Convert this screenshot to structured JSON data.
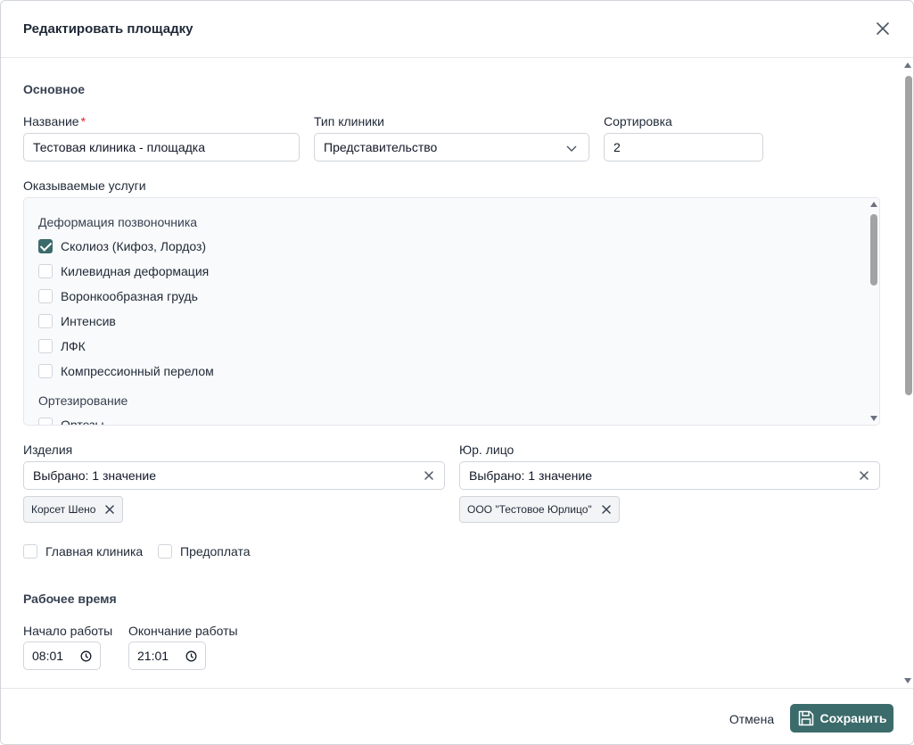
{
  "dialog": {
    "title": "Редактировать площадку",
    "close_icon": "close-icon"
  },
  "basic": {
    "section_title": "Основное",
    "name_label": "Название",
    "name_required_mark": "*",
    "name_value": "Тестовая клиника - площадка",
    "clinic_type_label": "Тип клиники",
    "clinic_type_value": "Представительство",
    "sort_label": "Сортировка",
    "sort_value": "2"
  },
  "services": {
    "label": "Оказываемые услуги",
    "groups": [
      {
        "title": "Деформация позвоночника",
        "items": [
          {
            "label": "Сколиоз (Кифоз, Лордоз)",
            "checked": true
          },
          {
            "label": "Килевидная деформация",
            "checked": false
          },
          {
            "label": "Воронкообразная грудь",
            "checked": false
          },
          {
            "label": "Интенсив",
            "checked": false
          },
          {
            "label": "ЛФК",
            "checked": false
          },
          {
            "label": "Компрессионный перелом",
            "checked": false
          }
        ]
      },
      {
        "title": "Ортезирование",
        "items": [
          {
            "label": "Ортезы",
            "checked": false
          }
        ]
      }
    ]
  },
  "products": {
    "label": "Изделия",
    "value": "Выбрано: 1 значение",
    "chips": [
      "Корсет Шено"
    ]
  },
  "legal_entity": {
    "label": "Юр. лицо",
    "value": "Выбрано: 1 значение",
    "chips": [
      "ООО \"Тестовое Юрлицо\""
    ]
  },
  "flags": {
    "main_clinic": {
      "label": "Главная клиника",
      "checked": false
    },
    "prepayment": {
      "label": "Предоплата",
      "checked": false
    }
  },
  "work_time": {
    "section_title": "Рабочее время",
    "start_label": "Начало работы",
    "start_value": "08:01",
    "end_label": "Окончание работы",
    "end_value": "21:01"
  },
  "footer": {
    "cancel_label": "Отмена",
    "save_label": "Сохранить"
  },
  "colors": {
    "accent": "#3b6b6a",
    "required": "#dc2626"
  }
}
